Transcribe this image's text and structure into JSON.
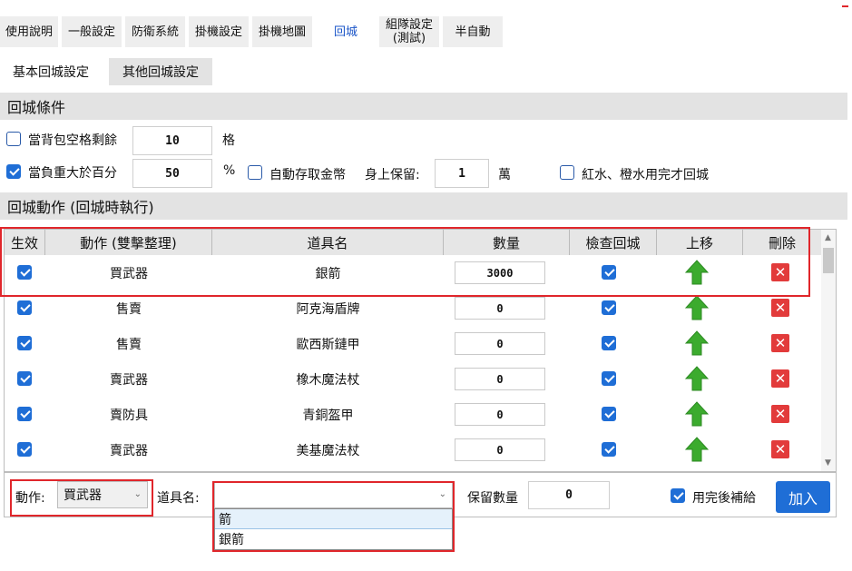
{
  "tabs": [
    "使用說明",
    "一般設定",
    "防衛系統",
    "掛機設定",
    "掛機地圖",
    "回城",
    "組隊設定\n(測試)",
    "半自動"
  ],
  "active_tab": "回城",
  "subtabs": [
    "基本回城設定",
    "其他回城設定"
  ],
  "conditions": {
    "title": "回城條件",
    "bag_label": "當背包空格剩餘",
    "bag_value": "10",
    "bag_unit": "格",
    "weight_label": "當負重大於百分",
    "weight_value": "50",
    "weight_unit": "%",
    "auto_gold_label": "自動存取金幣",
    "keep_label": "身上保留:",
    "keep_value": "1",
    "keep_unit": "萬",
    "potion_label": "紅水、橙水用完才回城"
  },
  "actions": {
    "title": "回城動作 (回城時執行)",
    "headers": [
      "生效",
      "動作 (雙擊整理)",
      "道具名",
      "數量",
      "檢查回城",
      "上移",
      "刪除"
    ],
    "rows": [
      {
        "action": "買武器",
        "item": "銀箭",
        "qty": "3000"
      },
      {
        "action": "售賣",
        "item": "阿克海盾牌",
        "qty": "0"
      },
      {
        "action": "售賣",
        "item": "歐西斯鏈甲",
        "qty": "0"
      },
      {
        "action": "賣武器",
        "item": "橡木魔法杖",
        "qty": "0"
      },
      {
        "action": "賣防具",
        "item": "青銅盔甲",
        "qty": "0"
      },
      {
        "action": "賣武器",
        "item": "美基魔法杖",
        "qty": "0"
      }
    ]
  },
  "bottom": {
    "action_label": "動作:",
    "action_value": "買武器",
    "item_label": "道具名:",
    "item_value": "",
    "dropdown_options": [
      "箭",
      "銀箭"
    ],
    "keep_qty_label": "保留數量",
    "keep_qty_value": "0",
    "refill_label": "用完後補給",
    "add_label": "加入"
  },
  "colors": {
    "accent": "#1f6ed6",
    "highlight": "#e0262b",
    "delete": "#e23b3b",
    "arrow": "#3cab2e"
  }
}
